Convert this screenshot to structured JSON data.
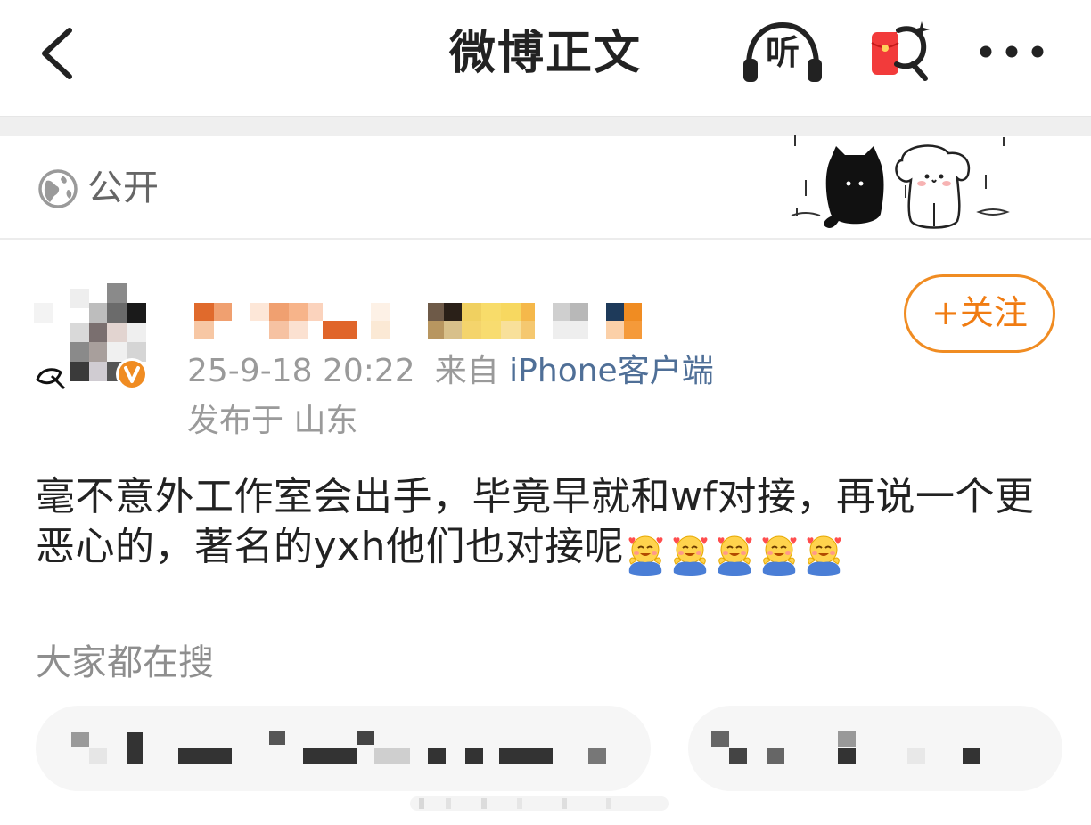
{
  "navbar": {
    "title": "微博正文",
    "listen_label": "听",
    "icons": [
      "back-icon",
      "listen-icon",
      "red-packet-search-icon",
      "more-icon"
    ]
  },
  "privacy": {
    "label": "公开",
    "icon": "globe-icon"
  },
  "post": {
    "date_time": "25-9-18 20:22",
    "source_prefix": "来自",
    "source": "iPhone客户端",
    "location": "发布于 山东",
    "follow_label": "+关注",
    "text": "毫不意外工作室会出手，毕竟早就和wf对接，再说一个更恶心的，著名的yxh他们也对接呢",
    "emoji_count": 5,
    "emoji_name": "hug-emoji"
  },
  "trending": {
    "label": "大家都在搜"
  },
  "colors": {
    "accent": "#f07c12",
    "source_link": "#4f6f97",
    "muted": "#9a9a9a"
  }
}
